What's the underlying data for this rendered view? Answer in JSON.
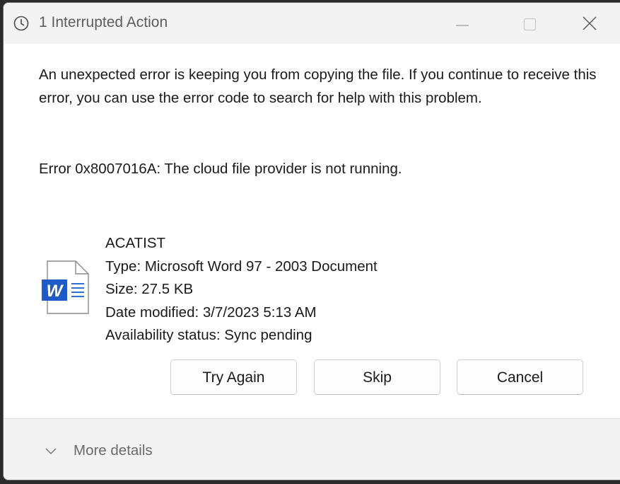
{
  "window": {
    "title": "1 Interrupted Action",
    "icon": "clock-icon",
    "controls": [
      "minimize-icon",
      "maximize-icon",
      "close-icon"
    ]
  },
  "message": {
    "body": "An unexpected error is keeping you from copying the file. If you continue to receive this error, you can use the error code to search for help with this problem.",
    "error": "Error 0x8007016A: The cloud file provider is not running."
  },
  "file": {
    "icon": "word-document-icon",
    "name": "ACATIST",
    "type": "Type: Microsoft Word 97 - 2003 Document",
    "size": "Size: 27.5 KB",
    "date_modified": "Date modified: 3/7/2023 5:13 AM",
    "availability": "Availability status: Sync pending"
  },
  "buttons": {
    "try_again": "Try Again",
    "skip": "Skip",
    "cancel": "Cancel"
  },
  "footer": {
    "more_details": "More details",
    "icon": "chevron-down-icon"
  },
  "colors": {
    "titlebar_bg": "#f3f3f3",
    "body_bg": "#ffffff",
    "word_blue": "#1e5bc6"
  }
}
